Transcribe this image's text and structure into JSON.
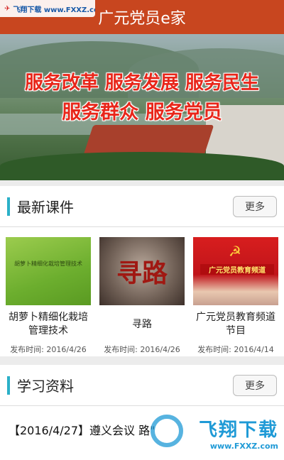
{
  "header": {
    "title": "广元党员e家"
  },
  "watermark_top": {
    "text": "飞翔下载 www.FXXZ.com"
  },
  "banner": {
    "slogan_line1": "服务改革 服务发展 服务民生",
    "slogan_line2": "服务群众 服务党员"
  },
  "latest_courses": {
    "title": "最新课件",
    "more_label": "更多",
    "items": [
      {
        "title": "胡萝卜精细化栽培管理技术",
        "thumb_text": "胡萝卜精细化栽培管理技术",
        "date": "发布时间: 2016/4/26"
      },
      {
        "title": "寻路",
        "thumb_text": "寻路",
        "date": "发布时间: 2016/4/26"
      },
      {
        "title": "广元党员教育频道节目",
        "thumb_text": "广元党员教育频道",
        "date": "发布时间: 2016/4/14"
      }
    ]
  },
  "study_materials": {
    "title": "学习资料",
    "more_label": "更多",
    "first_article": "【2016/4/27】遵义会议 路\""
  },
  "watermark_bottom": {
    "big": "飞翔下载",
    "small": "www.FXXZ.com"
  },
  "colors": {
    "header": "#c8461f",
    "accent_bar": "#2bb0c8"
  }
}
